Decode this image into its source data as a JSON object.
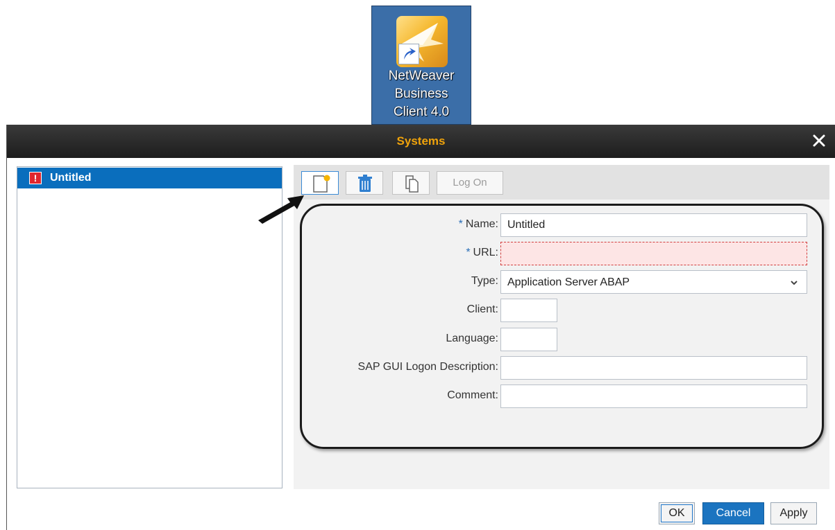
{
  "desktop_icon": {
    "caption_line1": "NetWeaver",
    "caption_line2": "Business",
    "caption_line3": "Client 4.0",
    "icon": "netweaver-app-icon"
  },
  "dialog": {
    "title": "Systems",
    "close_icon": "close-icon"
  },
  "system_list": {
    "items": [
      {
        "label": "Untitled",
        "status_icon": "error-icon",
        "selected": true
      }
    ]
  },
  "toolbar": {
    "new_icon": "new-document-icon",
    "delete_icon": "trash-icon",
    "copy_icon": "copy-icon",
    "logon_label": "Log On"
  },
  "form": {
    "name_label": "Name:",
    "name_value": "Untitled",
    "url_label": "URL:",
    "url_value": "",
    "type_label": "Type:",
    "type_value": "Application Server ABAP",
    "client_label": "Client:",
    "client_value": "",
    "language_label": "Language:",
    "language_value": "",
    "sapgui_label": "SAP GUI Logon Description:",
    "sapgui_value": "",
    "comment_label": "Comment:",
    "comment_value": "",
    "required_marker": "*"
  },
  "buttons": {
    "ok": "OK",
    "cancel": "Cancel",
    "apply": "Apply"
  },
  "colors": {
    "title_text": "#f0a30a",
    "selection": "#0a6ebd",
    "error_field_bg": "#fde5e5",
    "primary_button": "#1b74c0"
  }
}
